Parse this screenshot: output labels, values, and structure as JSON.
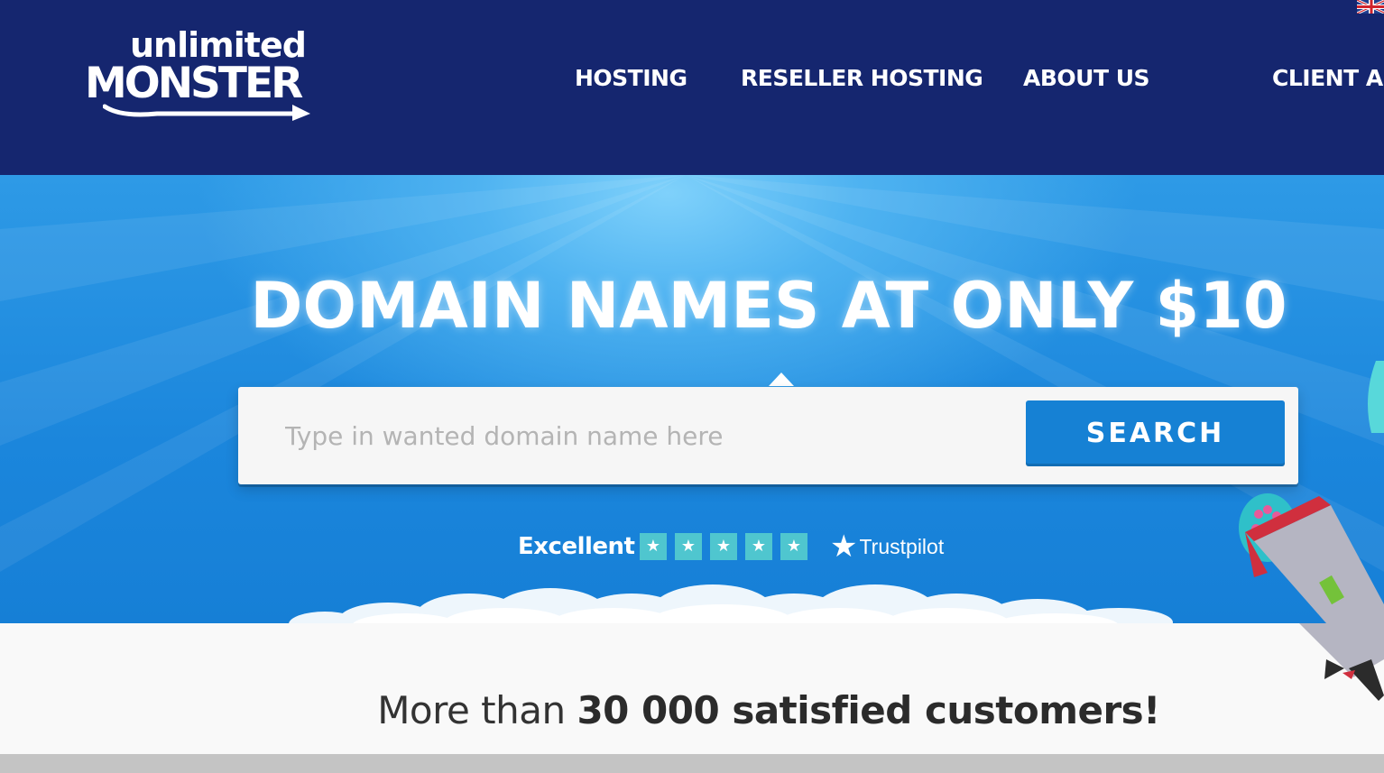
{
  "header": {
    "logo": {
      "line1": "unlimited",
      "line2": "MONSTER"
    },
    "nav": [
      {
        "label": "HOSTING"
      },
      {
        "label": "RESELLER HOSTING"
      },
      {
        "label": "ABOUT US"
      },
      {
        "label": "CLIENT AR"
      }
    ],
    "language_flag": "uk-flag-icon"
  },
  "hero": {
    "title": "DOMAIN NAMES AT ONLY $10",
    "search": {
      "placeholder": "Type in wanted domain name here",
      "value": "",
      "button_label": "SEARCH"
    },
    "rating": {
      "label": "Excellent",
      "stars": 5,
      "provider": "Trustpilot"
    }
  },
  "customers": {
    "prefix": "More than ",
    "highlight": "30 000 satisfied customers!"
  },
  "colors": {
    "header_bg": "#15266f",
    "hero_blue": "#1b86dc",
    "search_button": "#1681d4",
    "trustpilot_green": "#4fc6cf"
  }
}
